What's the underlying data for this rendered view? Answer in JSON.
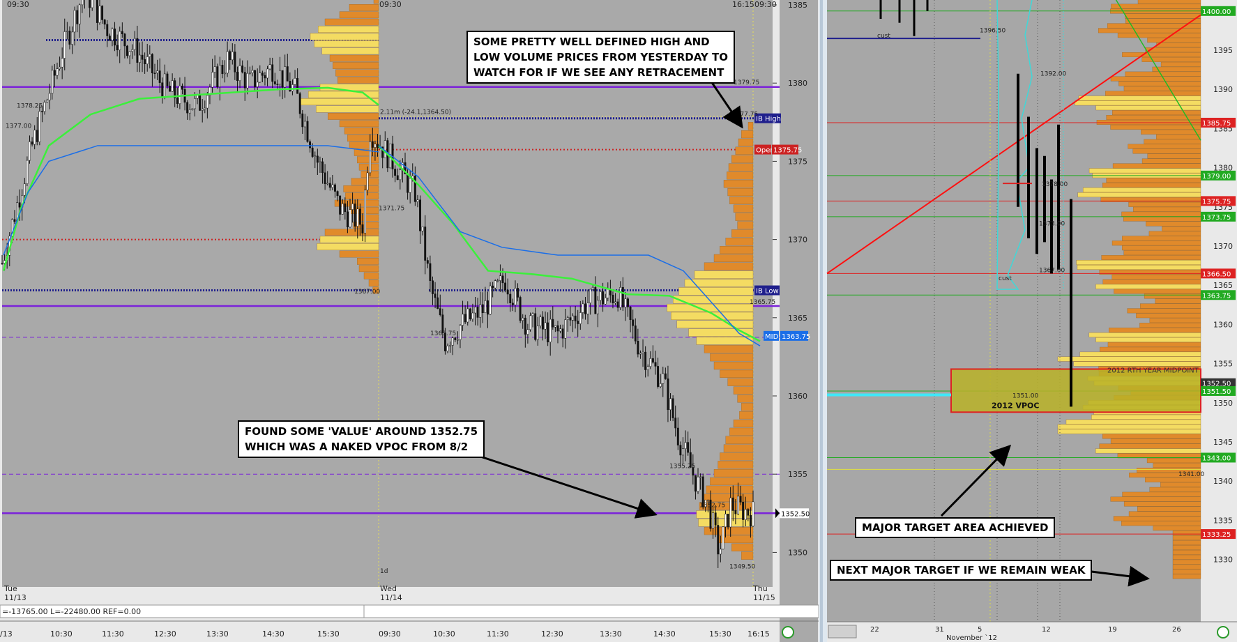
{
  "colors": {
    "chart_bg": "#a9a9a9",
    "right_bg": "#a7a7a7",
    "axis_bg": "#e9e9e9",
    "purple_line": "#7b22d9",
    "navy_line": "#1f1f8c",
    "green_vwap": "#3bf03b",
    "blue_line": "#1a6ee8",
    "red_dotted": "#cc2222",
    "orange_profile": "#e08a2b",
    "yellow_profile": "#f4dc62",
    "red_trend": "#ff1010",
    "target_box": "#b8b227"
  },
  "left_chart": {
    "time_top": [
      "09:30",
      "09:30",
      "16:15",
      "09:30"
    ],
    "price_ticks": [
      "1385",
      "1380",
      "1375",
      "1370",
      "1365",
      "1360",
      "1355",
      "1350"
    ],
    "price_tags": {
      "ib_high": "IB High",
      "open": "Open",
      "open_price": "1375.75",
      "ib_low": "IB Low",
      "mid": "MID",
      "mid_price": "1363.75",
      "last": "1352.50"
    },
    "level_labels": [
      "1379.75",
      "1377.75",
      "1378.25",
      "1377.00",
      "1371.75",
      "1367.00",
      "1365.75",
      "1363.75",
      "1355.25",
      "1352.75",
      "1349.50"
    ],
    "ib_range_label": "2.11m (-24.1,1364.50)",
    "day_label": "1d",
    "day_headers": [
      {
        "dow": "Tue",
        "date": "11/13"
      },
      {
        "dow": "Wed",
        "date": "11/14"
      },
      {
        "dow": "Thu",
        "date": "11/15"
      }
    ],
    "indicator_text": "=-13765.00 L=-22480.00 REF=0.00",
    "time_axis": [
      "/13",
      "10:30",
      "11:30",
      "12:30",
      "13:30",
      "14:30",
      "15:30",
      "09:30",
      "10:30",
      "11:30",
      "12:30",
      "13:30",
      "14:30",
      "15:30",
      "16:15"
    ]
  },
  "right_chart": {
    "price_ticks": [
      "1395",
      "1390",
      "1385",
      "1380",
      "1375",
      "1370",
      "1365",
      "1360",
      "1355",
      "1350",
      "1345",
      "1340",
      "1335",
      "1330"
    ],
    "price_tags": [
      {
        "text": "1400.00",
        "color": "#22aa22"
      },
      {
        "text": "1385.75",
        "color": "#dd2222"
      },
      {
        "text": "1379.00",
        "color": "#22aa22"
      },
      {
        "text": "1375.75",
        "color": "#dd2222"
      },
      {
        "text": "1373.75",
        "color": "#22aa22"
      },
      {
        "text": "1366.50",
        "color": "#dd2222"
      },
      {
        "text": "1363.75",
        "color": "#22aa22"
      },
      {
        "text": "1352.50",
        "color": "#333333"
      },
      {
        "text": "1351.50",
        "color": "#22aa22"
      },
      {
        "text": "1343.00",
        "color": "#22aa22"
      },
      {
        "text": "1333.25",
        "color": "#dd2222"
      }
    ],
    "small_labels": [
      "1392.00",
      "1378.00",
      "1373.00",
      "1367.00",
      "1351.00",
      "1341.00",
      "cust",
      "cust",
      "1396.50"
    ],
    "midpoint_label": "2012 RTH YEAR MIDPOINT",
    "vpoc_label": "2012 VPOC",
    "date_axis": [
      "22",
      "31",
      "5",
      "12",
      "19",
      "26"
    ],
    "month_label": "November `12"
  },
  "callouts": {
    "top": "SOME PRETTY WELL DEFINED HIGH AND\nLOW VOLUME PRICES FROM YESTERDAY TO\nWATCH FOR IF WE SEE ANY RETRACEMENT",
    "value": "FOUND SOME 'VALUE' AROUND 1352.75\nWHICH WAS A NAKED VPOC FROM 8/2",
    "target": "MAJOR TARGET AREA ACHIEVED",
    "next": "NEXT MAJOR TARGET IF WE REMAIN WEAK"
  },
  "chart_data": [
    {
      "type": "candlestick",
      "title": "",
      "ylim": [
        1347,
        1386.5
      ],
      "sessions": [
        "Tue 11/13",
        "Wed 11/14",
        "Thu 11/15"
      ],
      "levels": [
        {
          "name": "IB High",
          "value": 1377.75
        },
        {
          "name": "Open",
          "value": 1375.75
        },
        {
          "name": "IB Low",
          "value": 1366.75
        },
        {
          "name": "MID",
          "value": 1363.75
        },
        {
          "value": 1379.75
        },
        {
          "value": 1365.75
        },
        {
          "value": 1352.5
        }
      ],
      "price_path": [
        {
          "x": 0.0,
          "y": 1368.5
        },
        {
          "x": 0.04,
          "y": 1376.0
        },
        {
          "x": 0.08,
          "y": 1382.0
        },
        {
          "x": 0.11,
          "y": 1386.0
        },
        {
          "x": 0.14,
          "y": 1383.5
        },
        {
          "x": 0.18,
          "y": 1382.0
        },
        {
          "x": 0.22,
          "y": 1379.5
        },
        {
          "x": 0.26,
          "y": 1378.5
        },
        {
          "x": 0.3,
          "y": 1381.5
        },
        {
          "x": 0.33,
          "y": 1380.0
        },
        {
          "x": 0.36,
          "y": 1381.0
        },
        {
          "x": 0.39,
          "y": 1379.5
        },
        {
          "x": 0.42,
          "y": 1375.0
        },
        {
          "x": 0.45,
          "y": 1372.0
        },
        {
          "x": 0.48,
          "y": 1371.0
        },
        {
          "x": 0.49,
          "y": 1377.0
        },
        {
          "x": 0.52,
          "y": 1375.0
        },
        {
          "x": 0.55,
          "y": 1373.0
        },
        {
          "x": 0.57,
          "y": 1367.0
        },
        {
          "x": 0.59,
          "y": 1363.5
        },
        {
          "x": 0.61,
          "y": 1364.5
        },
        {
          "x": 0.64,
          "y": 1365.5
        },
        {
          "x": 0.67,
          "y": 1367.5
        },
        {
          "x": 0.7,
          "y": 1364.5
        },
        {
          "x": 0.74,
          "y": 1364.0
        },
        {
          "x": 0.78,
          "y": 1366.0
        },
        {
          "x": 0.82,
          "y": 1366.5
        },
        {
          "x": 0.85,
          "y": 1363.0
        },
        {
          "x": 0.88,
          "y": 1361.0
        },
        {
          "x": 0.9,
          "y": 1357.5
        },
        {
          "x": 0.92,
          "y": 1355.0
        },
        {
          "x": 0.94,
          "y": 1353.0
        },
        {
          "x": 0.955,
          "y": 1350.0
        },
        {
          "x": 0.97,
          "y": 1353.0
        },
        {
          "x": 1.0,
          "y": 1352.5
        }
      ]
    },
    {
      "type": "bar",
      "title": "",
      "ylim": [
        1327.5,
        1401.5
      ],
      "levels": [
        {
          "value": 1400.0
        },
        {
          "value": 1385.75
        },
        {
          "value": 1379.0
        },
        {
          "value": 1375.75
        },
        {
          "value": 1373.75
        },
        {
          "value": 1366.5
        },
        {
          "value": 1363.75
        },
        {
          "value": 1352.5
        },
        {
          "value": 1351.5
        },
        {
          "value": 1343.0
        },
        {
          "value": 1333.25
        }
      ],
      "target_zone": {
        "low": 1348.8,
        "high": 1354.3
      },
      "daily_bars": [
        {
          "high": 1392.0,
          "low": 1375.0
        },
        {
          "high": 1386.5,
          "low": 1371.0
        },
        {
          "high": 1382.5,
          "low": 1369.0
        },
        {
          "high": 1381.5,
          "low": 1370.5
        },
        {
          "high": 1378.5,
          "low": 1366.5
        },
        {
          "high": 1385.5,
          "low": 1367.0
        },
        {
          "high": 1375.5,
          "low": 1349.5
        }
      ]
    }
  ]
}
